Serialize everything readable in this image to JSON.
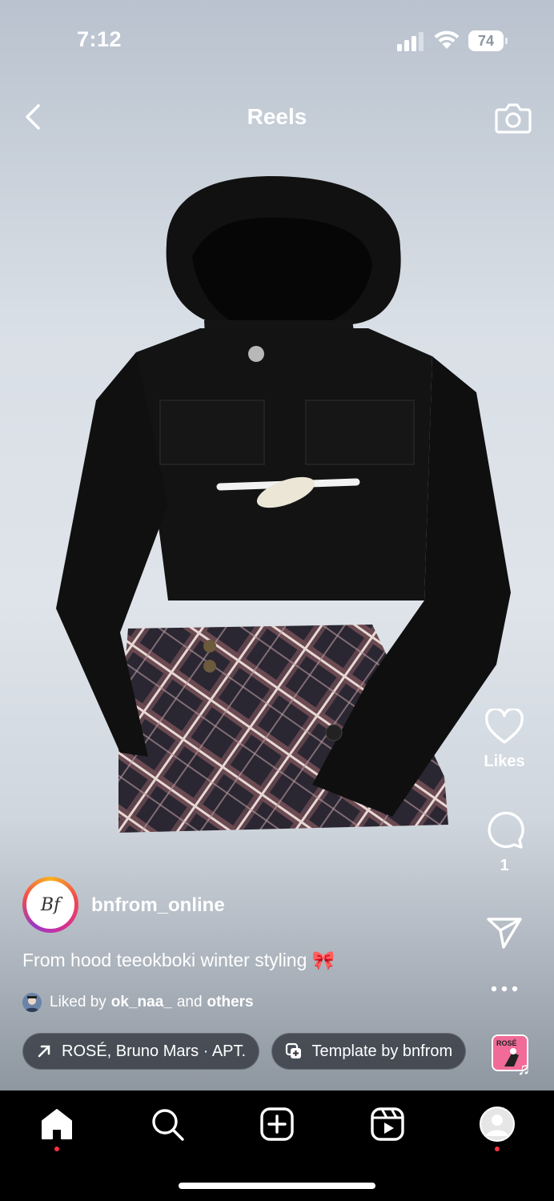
{
  "status_bar": {
    "time": "7:12",
    "battery_level": "74",
    "icons": [
      "signal-icon",
      "wifi-icon",
      "battery-icon"
    ]
  },
  "header": {
    "title": "Reels",
    "back_icon": "chevron-left-icon",
    "camera_icon": "camera-icon"
  },
  "actions": {
    "like_label": "Likes",
    "comment_count": "1",
    "icons": [
      "heart-icon",
      "comment-icon",
      "send-icon",
      "more-icon"
    ]
  },
  "post": {
    "username": "bnfrom_online",
    "avatar_text": "Bf",
    "caption": "From hood teeokboki winter styling 🎀",
    "liked_by_prefix": "Liked by",
    "liked_by_user": "ok_naa_",
    "liked_by_and": "and",
    "liked_by_others": "others"
  },
  "chips": {
    "music": "ROSÉ, Bruno Mars · APT.",
    "template": "Template by bnfrom"
  },
  "music_thumb": {
    "text": "ROSÉ"
  },
  "tabbar": {
    "items": [
      "home-icon",
      "search-icon",
      "create-icon",
      "reels-icon",
      "profile-icon"
    ]
  },
  "colors": {
    "notification_dot": "#ff3040",
    "avatar_ring": "#d82f8f"
  }
}
